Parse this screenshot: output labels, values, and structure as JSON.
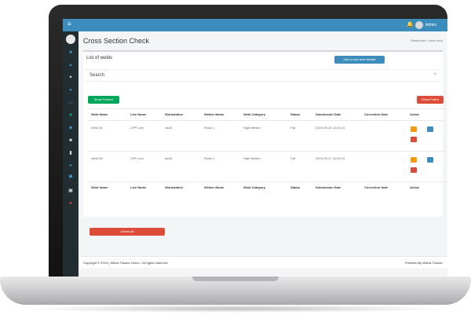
{
  "topbar": {
    "hamburger": "≡",
    "bell": "🔔",
    "user": "Admin"
  },
  "page": {
    "title": "Cross Section Check",
    "breadcrumb": "Dashboard / cross-sect"
  },
  "panel": {
    "heading": "List of welds",
    "add_button": "Add a new weld details",
    "search_label": "Search",
    "search_plus": "+",
    "show_passed": "Show Passed",
    "show_failed": "Show Failed"
  },
  "table": {
    "columns": [
      "Weld Name",
      "Line Name",
      "Workstation",
      "Welder Name",
      "Weld Category",
      "Status",
      "Submission Date",
      "Correction Date",
      "Action"
    ],
    "rows": [
      [
        "Weld 34",
        "CPP Line",
        "ws45",
        "Rossi 1",
        "High Welder",
        "Fail",
        "2019-05-16 13:20:14",
        "",
        ""
      ],
      [
        "Weld 38",
        "CPP Line",
        "ws45",
        "Rossi 1",
        "High Welder",
        "Fail",
        "2019-05-17 13:20:14",
        "",
        ""
      ]
    ],
    "delete_all": "Delete All"
  },
  "footer": {
    "left": "Copyright © 2019 | Welds Tracker Demo - All rights reserved.",
    "right": "Powered By Welds Tracker"
  },
  "colors": {
    "primary": "#3c8dbc",
    "success": "#00a65a",
    "danger": "#dd4b39",
    "warning": "#f39c12",
    "sidebar": "#222d32"
  }
}
